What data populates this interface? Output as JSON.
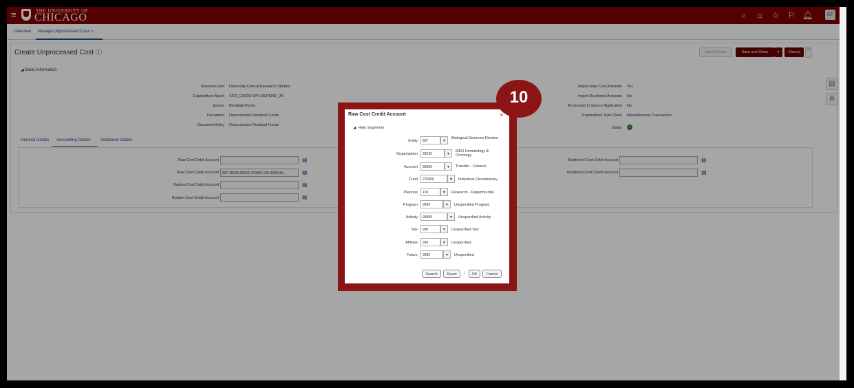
{
  "header": {
    "logo_line1": "THE UNIVERSITY OF",
    "logo_line2": "CHICAGO",
    "user_initials": "CF"
  },
  "tabs": [
    {
      "label": "Overview"
    },
    {
      "label": "Manage Unprocessed Costs"
    }
  ],
  "page": {
    "title": "Create Unprocessed Cost",
    "import_costs": "Import Costs",
    "save_close": "Save and Close",
    "cancel": "Cancel",
    "section": "Basic Information"
  },
  "basic_left": [
    {
      "label": "Business Unit",
      "value": "University Clinical Research Studies"
    },
    {
      "label": "Expenditure Batch",
      "value": "SIT2_CA209-SPH DEPEND_JR"
    },
    {
      "label": "Source",
      "value": "Residual Funds"
    },
    {
      "label": "Document",
      "value": "Unaccounted Residual Funds"
    },
    {
      "label": "Document Entry",
      "value": "Unaccounted Residual Funds"
    }
  ],
  "basic_right": [
    {
      "label": "Import Raw Cost Amounts",
      "value": "Yes"
    },
    {
      "label": "Import Burdened Amounts",
      "value": "No"
    },
    {
      "label": "Accounted in Source Application",
      "value": "No"
    },
    {
      "label": "Expenditure Type Class",
      "value": "Miscellaneous Transaction"
    },
    {
      "label": "Status",
      "value": ""
    }
  ],
  "subtabs": [
    {
      "label": "General Details"
    },
    {
      "label": "Accounting Details"
    },
    {
      "label": "Additional Details"
    }
  ],
  "accounts_left": [
    {
      "label": "Raw Cost Debit Account",
      "value": ""
    },
    {
      "label": "Raw Cost Credit Account",
      "value": "807-28220-95000-270800-130-9999-99..."
    },
    {
      "label": "Burden Cost Debit Account",
      "value": ""
    },
    {
      "label": "Burden Cost Credit Account",
      "value": ""
    }
  ],
  "accounts_right": [
    {
      "label": "Burdened Cost Debit Account",
      "value": ""
    },
    {
      "label": "Burdened Cost Credit Account",
      "value": ""
    }
  ],
  "dialog": {
    "title": "Raw Cost Credit Account",
    "hide_segments": "Hide Segments",
    "segments": [
      {
        "label": "Entity",
        "value": "807",
        "desc": "Biological Sciences Division"
      },
      {
        "label": "Organization",
        "value": "28220",
        "desc": "MED Hematology & Oncology"
      },
      {
        "label": "Account",
        "value": "95000",
        "desc": "Transfer - General"
      },
      {
        "label": "Fund",
        "value": "270800",
        "desc": "Individual Discretionary"
      },
      {
        "label": "Purpose",
        "value": "130",
        "desc": "Research - Departmental"
      },
      {
        "label": "Program",
        "value": "9999",
        "desc": "Unspecified Program"
      },
      {
        "label": "Activity",
        "value": "99999",
        "desc": "Unspecified Activity"
      },
      {
        "label": "Site",
        "value": "999",
        "desc": "Unspecified Site"
      },
      {
        "label": "Affiliate",
        "value": "999",
        "desc": "Unspecified"
      },
      {
        "label": "Future",
        "value": "9999",
        "desc": "Unspecified"
      }
    ],
    "search": "Search",
    "reset": "Reset",
    "ok": "OK",
    "cancel": "Cancel"
  },
  "step_badge": "10",
  "colors": {
    "brand": "#800000",
    "link": "#1a4d8c",
    "badge": "#8b1515"
  }
}
